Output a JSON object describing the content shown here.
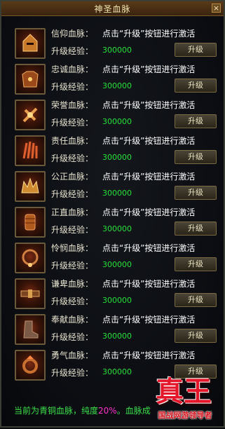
{
  "window": {
    "title": "神圣血脉",
    "close_icon": "close-icon"
  },
  "rows": [
    {
      "name": "信仰血脉：",
      "desc": "点击“升级”按钮进行激活",
      "exp_label": "升级经验：",
      "exp_value": "300000",
      "button": "升级",
      "icon": "helmet-icon"
    },
    {
      "name": "忠诚血脉：",
      "desc": "点击“升级”按钮进行激活",
      "exp_label": "升级经验：",
      "exp_value": "300000",
      "button": "升级",
      "icon": "armor-icon"
    },
    {
      "name": "荣誉血脉：",
      "desc": "点击“升级”按钮进行激活",
      "exp_label": "升级经验：",
      "exp_value": "300000",
      "button": "升级",
      "icon": "weapon-icon"
    },
    {
      "name": "责任血脉：",
      "desc": "点击“升级”按钮进行激活",
      "exp_label": "升级经验：",
      "exp_value": "300000",
      "button": "升级",
      "icon": "claw-icon"
    },
    {
      "name": "公正血脉：",
      "desc": "点击“升级”按钮进行激活",
      "exp_label": "升级经验：",
      "exp_value": "300000",
      "button": "升级",
      "icon": "crown-icon"
    },
    {
      "name": "正直血脉：",
      "desc": "点击“升级”按钮进行激活",
      "exp_label": "升级经验：",
      "exp_value": "300000",
      "button": "升级",
      "icon": "gauntlet-icon"
    },
    {
      "name": "怜悯血脉：",
      "desc": "点击“升级”按钮进行激活",
      "exp_label": "升级经验：",
      "exp_value": "300000",
      "button": "升级",
      "icon": "necklace-icon"
    },
    {
      "name": "谦卑血脉：",
      "desc": "点击“升级”按钮进行激活",
      "exp_label": "升级经验：",
      "exp_value": "300000",
      "button": "升级",
      "icon": "belt-icon"
    },
    {
      "name": "奉献血脉：",
      "desc": "点击“升级”按钮进行激活",
      "exp_label": "升级经验：",
      "exp_value": "300000",
      "button": "升级",
      "icon": "boots-icon"
    },
    {
      "name": "勇气血脉：",
      "desc": "点击“升级”按钮进行激活",
      "exp_label": "升级经验：",
      "exp_value": "300000",
      "button": "升级",
      "icon": "ring-icon"
    }
  ],
  "status": {
    "prefix": "当前为青铜血脉，纯度",
    "percent": "20%",
    "suffix": "。血脉成"
  },
  "logo": {
    "title": "真王",
    "subtitle": "国战网游领导者"
  },
  "colors": {
    "exp": "#27e13a",
    "percent": "#ff33cc",
    "status": "#3be04a",
    "logo": "#e4162a"
  }
}
